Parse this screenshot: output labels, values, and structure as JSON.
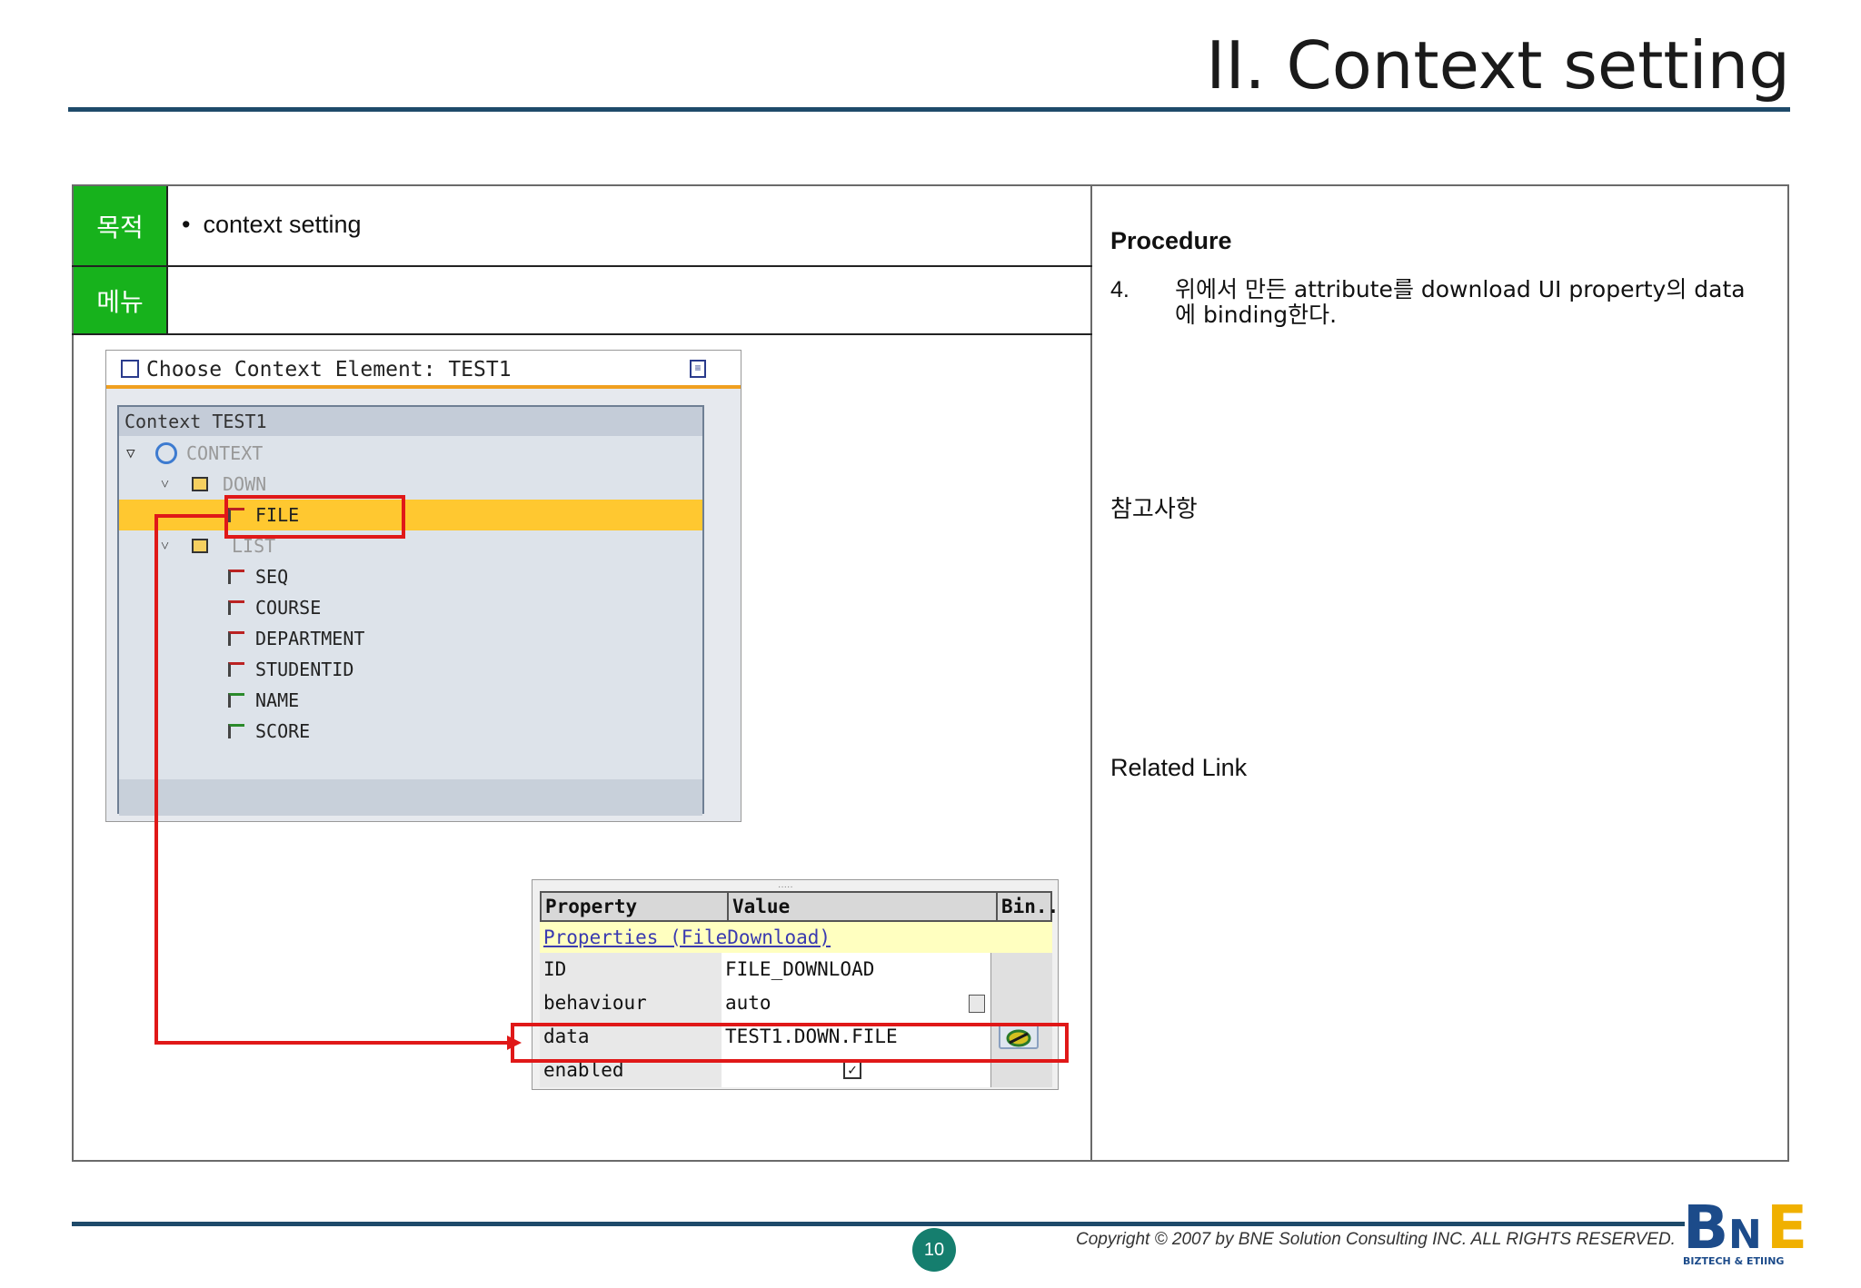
{
  "slide": {
    "title": "II. Context setting",
    "purpose_label": "목적",
    "purpose_item": "context setting",
    "menu_label": "메뉴",
    "procedure_heading": "Procedure",
    "step_number": "4.",
    "step_text": "위에서 만든 attribute를 download UI property의 data에 binding한다.",
    "notes_heading": "참고사항",
    "related_heading": "Related Link",
    "page_number": "10",
    "copyright": "Copyright © 2007 by BNE Solution Consulting INC.   ALL RIGHTS RESERVED.",
    "logo_text": "BNE",
    "logo_sub": "BIZTECH & ETIING"
  },
  "context_dialog": {
    "title": "Choose Context Element: TEST1",
    "tree_header": "Context TEST1",
    "nodes": [
      {
        "label": "CONTEXT",
        "type": "root",
        "state": "muted"
      },
      {
        "label": "DOWN",
        "type": "node",
        "state": "muted"
      },
      {
        "label": "FILE",
        "type": "attribute",
        "state": "selected"
      },
      {
        "label": "LIST",
        "type": "node",
        "state": "muted"
      },
      {
        "label": "SEQ",
        "type": "attribute",
        "state": "normal"
      },
      {
        "label": "COURSE",
        "type": "attribute",
        "state": "normal"
      },
      {
        "label": "DEPARTMENT",
        "type": "attribute",
        "state": "normal"
      },
      {
        "label": "STUDENTID",
        "type": "attribute",
        "state": "normal"
      },
      {
        "label": "NAME",
        "type": "attribute-green",
        "state": "normal"
      },
      {
        "label": "SCORE",
        "type": "attribute-green",
        "state": "normal"
      }
    ]
  },
  "properties": {
    "headers": {
      "property": "Property",
      "value": "Value",
      "binding": "Bin..."
    },
    "group_label": "Properties (FileDownload)",
    "rows": [
      {
        "property": "ID",
        "value": "FILE_DOWNLOAD"
      },
      {
        "property": "behaviour",
        "value": "auto"
      },
      {
        "property": "data",
        "value": "TEST1.DOWN.FILE"
      },
      {
        "property": "enabled",
        "value": "✓"
      }
    ]
  },
  "colors": {
    "accent_green": "#17b21c",
    "rule_blue": "#1e4a6a",
    "highlight_red": "#e01818",
    "selection_yellow": "#ffc830"
  }
}
